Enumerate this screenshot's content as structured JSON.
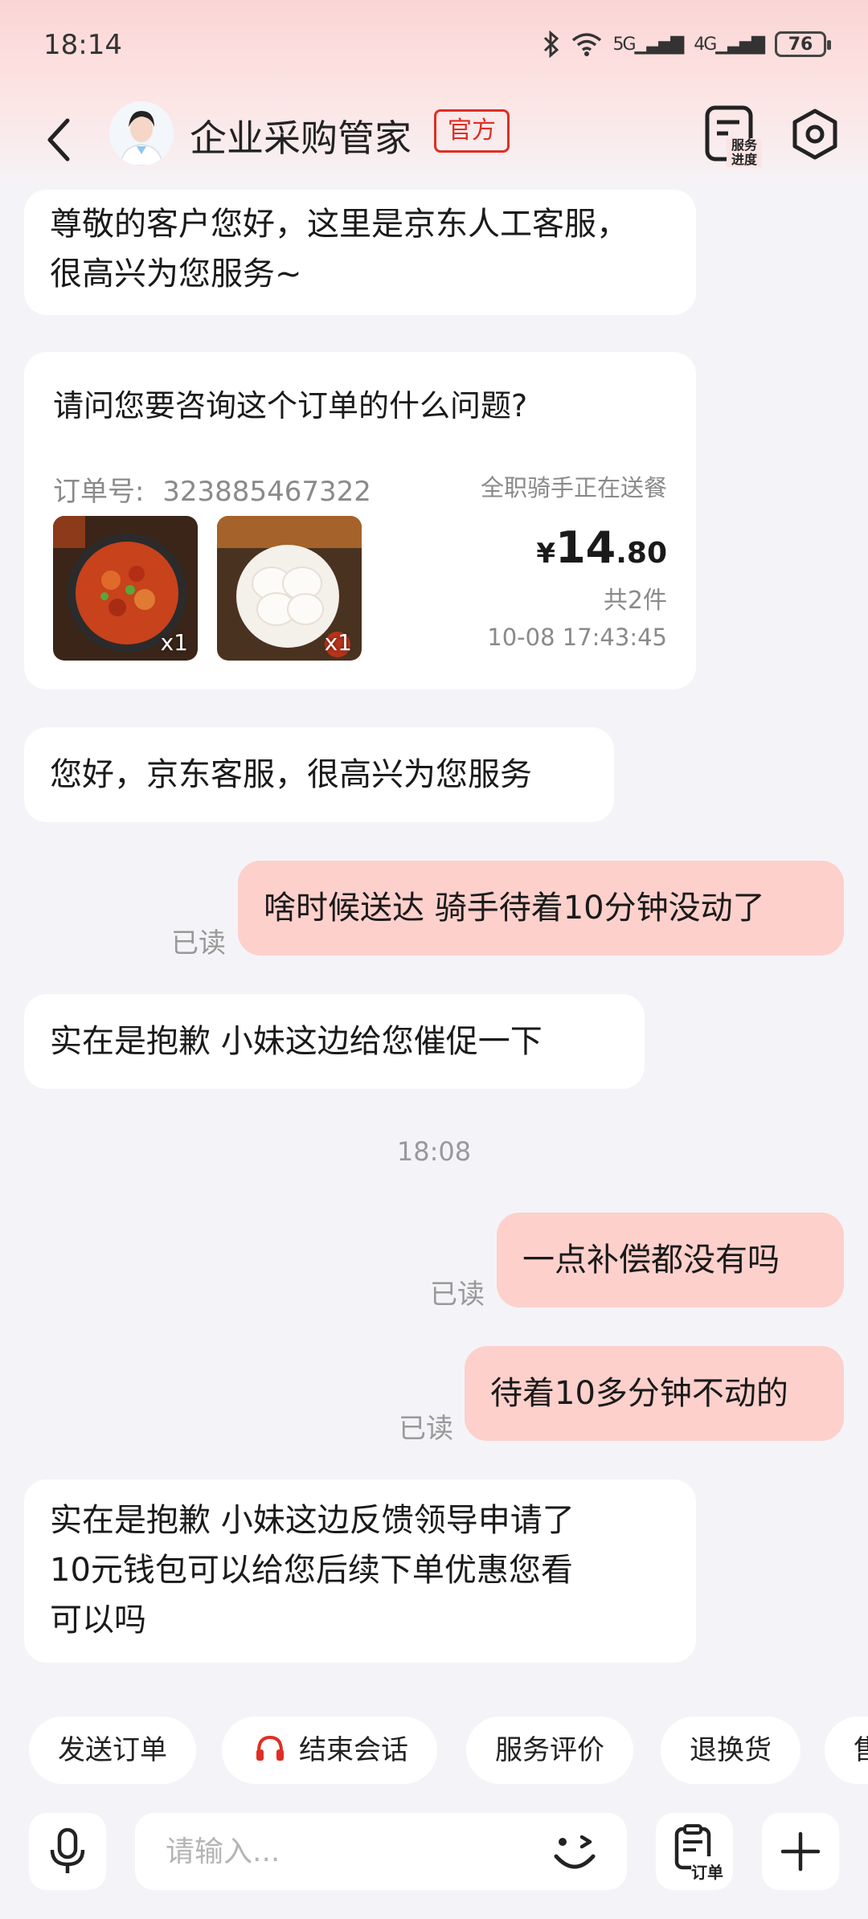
{
  "status_bar": {
    "time": "18:14",
    "network_1": "5G",
    "network_2": "4G",
    "battery": "76"
  },
  "header": {
    "title": "企业采购管家",
    "badge": "官方",
    "service_progress_label": "服务进度",
    "icons": [
      "back-arrow-icon",
      "service-progress-icon",
      "settings-hexagon-icon"
    ]
  },
  "messages": {
    "m1": {
      "side": "left",
      "line1": "尊敬的客户您好，这里是京东人工客服，",
      "line2": "很高兴为您服务~"
    },
    "m3": {
      "side": "left",
      "text": "您好，京东客服，很高兴为您服务"
    },
    "m4": {
      "side": "right",
      "text": "啥时候送达 骑手待着10分钟没动了",
      "read": "已读"
    },
    "m5": {
      "side": "left",
      "text": "实在是抱歉 小妹这边给您催促一下"
    },
    "time_divider": "18:08",
    "m6": {
      "side": "right",
      "text": "一点补偿都没有吗",
      "read": "已读"
    },
    "m7": {
      "side": "right",
      "text": "待着10多分钟不动的",
      "read": "已读"
    },
    "m8": {
      "side": "left",
      "line1": "实在是抱歉  小妹这边反馈领导申请了",
      "line2": "10元钱包可以给您后续下单优惠您看",
      "line3": "可以吗"
    }
  },
  "order_card": {
    "question": "请问您要咨询这个订单的什么问题?",
    "order_no_label": "订单号:",
    "order_no": "323885467322",
    "status": "全职骑手正在送餐",
    "currency": "¥",
    "price_int": "14",
    "price_dec": ".80",
    "count": "共2件",
    "time": "10-08 17:43:45",
    "items": [
      {
        "name": "spicy-chicken-dish",
        "qty": "x1"
      },
      {
        "name": "steamed-buns",
        "qty": "x1"
      }
    ]
  },
  "quick_actions": [
    "发送订单",
    "结束会话",
    "服务评价",
    "退换货",
    "售"
  ],
  "input": {
    "placeholder": "请输入...",
    "order_button_label": "订单"
  },
  "colors": {
    "accent": "#e02e24",
    "right_bubble": "#fdd0cc",
    "background": "#f4f4f8"
  }
}
